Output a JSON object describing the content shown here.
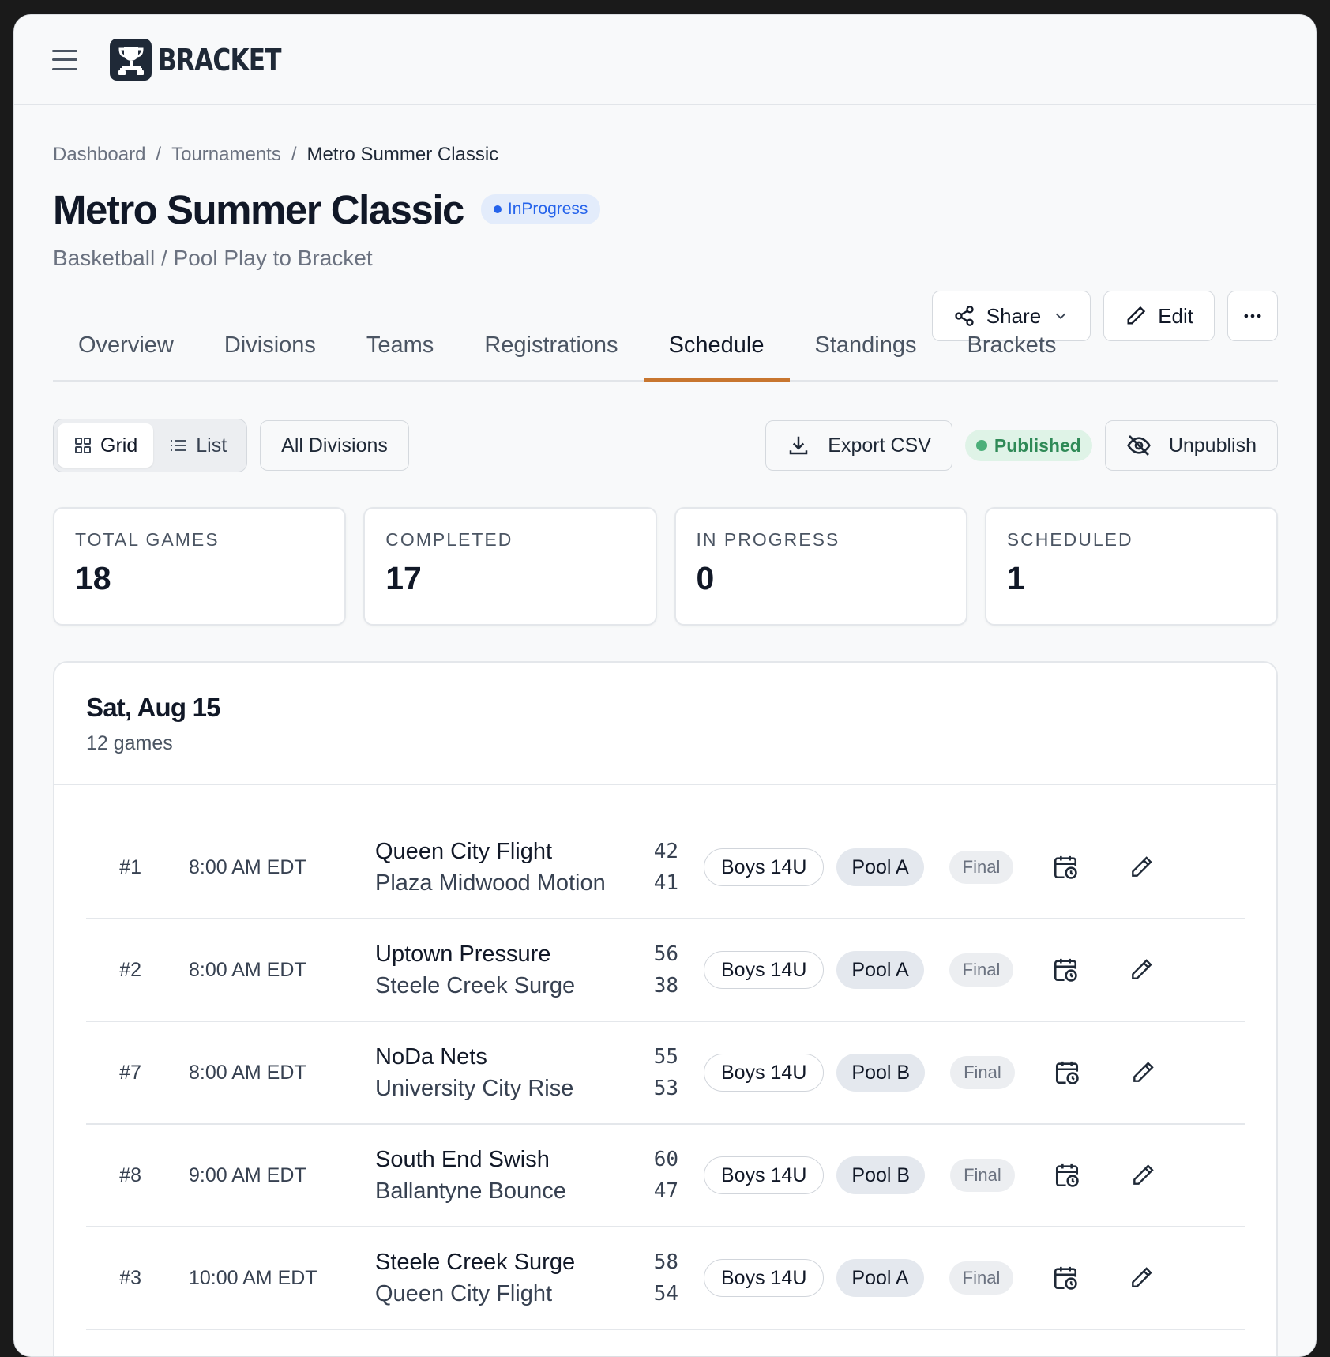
{
  "app": {
    "logo_text": "BRACKET",
    "icons": {
      "menu": "hamburger-icon",
      "logo": "trophy-bracket-icon"
    }
  },
  "breadcrumb": [
    {
      "label": "Dashboard"
    },
    {
      "label": "Tournaments"
    },
    {
      "label": "Metro Summer Classic"
    }
  ],
  "breadcrumb_separator": "/",
  "header": {
    "title": "Metro Summer Classic",
    "status": "InProgress",
    "subtitle": "Basketball / Pool Play to Bracket",
    "share_label": "Share",
    "edit_label": "Edit",
    "more_label": "···",
    "status_color": "#2563eb"
  },
  "tabs": [
    {
      "label": "Overview",
      "active": false
    },
    {
      "label": "Divisions",
      "active": false
    },
    {
      "label": "Teams",
      "active": false
    },
    {
      "label": "Registrations",
      "active": false
    },
    {
      "label": "Schedule",
      "active": true
    },
    {
      "label": "Standings",
      "active": false
    },
    {
      "label": "Brackets",
      "active": false
    }
  ],
  "accent_color": "#c8762f",
  "toolbar": {
    "view_grid": "Grid",
    "view_list": "List",
    "division_filter": "All Divisions",
    "export_label": "Export CSV",
    "published_label": "Published",
    "unpublish_label": "Unpublish"
  },
  "stats": [
    {
      "label": "TOTAL GAMES",
      "value": "18"
    },
    {
      "label": "COMPLETED",
      "value": "17"
    },
    {
      "label": "IN PROGRESS",
      "value": "0"
    },
    {
      "label": "SCHEDULED",
      "value": "1"
    }
  ],
  "day": {
    "title": "Sat, Aug 15",
    "count": "12 games",
    "games": [
      {
        "num": "#1",
        "time": "8:00 AM EDT",
        "home": "Queen City Flight",
        "away": "Plaza Midwood Motion",
        "home_score": "42",
        "away_score": "41",
        "division": "Boys 14U",
        "pool": "Pool A",
        "status": "Final"
      },
      {
        "num": "#2",
        "time": "8:00 AM EDT",
        "home": "Uptown Pressure",
        "away": "Steele Creek Surge",
        "home_score": "56",
        "away_score": "38",
        "division": "Boys 14U",
        "pool": "Pool A",
        "status": "Final"
      },
      {
        "num": "#7",
        "time": "8:00 AM EDT",
        "home": "NoDa Nets",
        "away": "University City Rise",
        "home_score": "55",
        "away_score": "53",
        "division": "Boys 14U",
        "pool": "Pool B",
        "status": "Final"
      },
      {
        "num": "#8",
        "time": "9:00 AM EDT",
        "home": "South End Swish",
        "away": "Ballantyne Bounce",
        "home_score": "60",
        "away_score": "47",
        "division": "Boys 14U",
        "pool": "Pool B",
        "status": "Final"
      },
      {
        "num": "#3",
        "time": "10:00 AM EDT",
        "home": "Steele Creek Surge",
        "away": "Queen City Flight",
        "home_score": "58",
        "away_score": "54",
        "division": "Boys 14U",
        "pool": "Pool A",
        "status": "Final"
      }
    ]
  }
}
